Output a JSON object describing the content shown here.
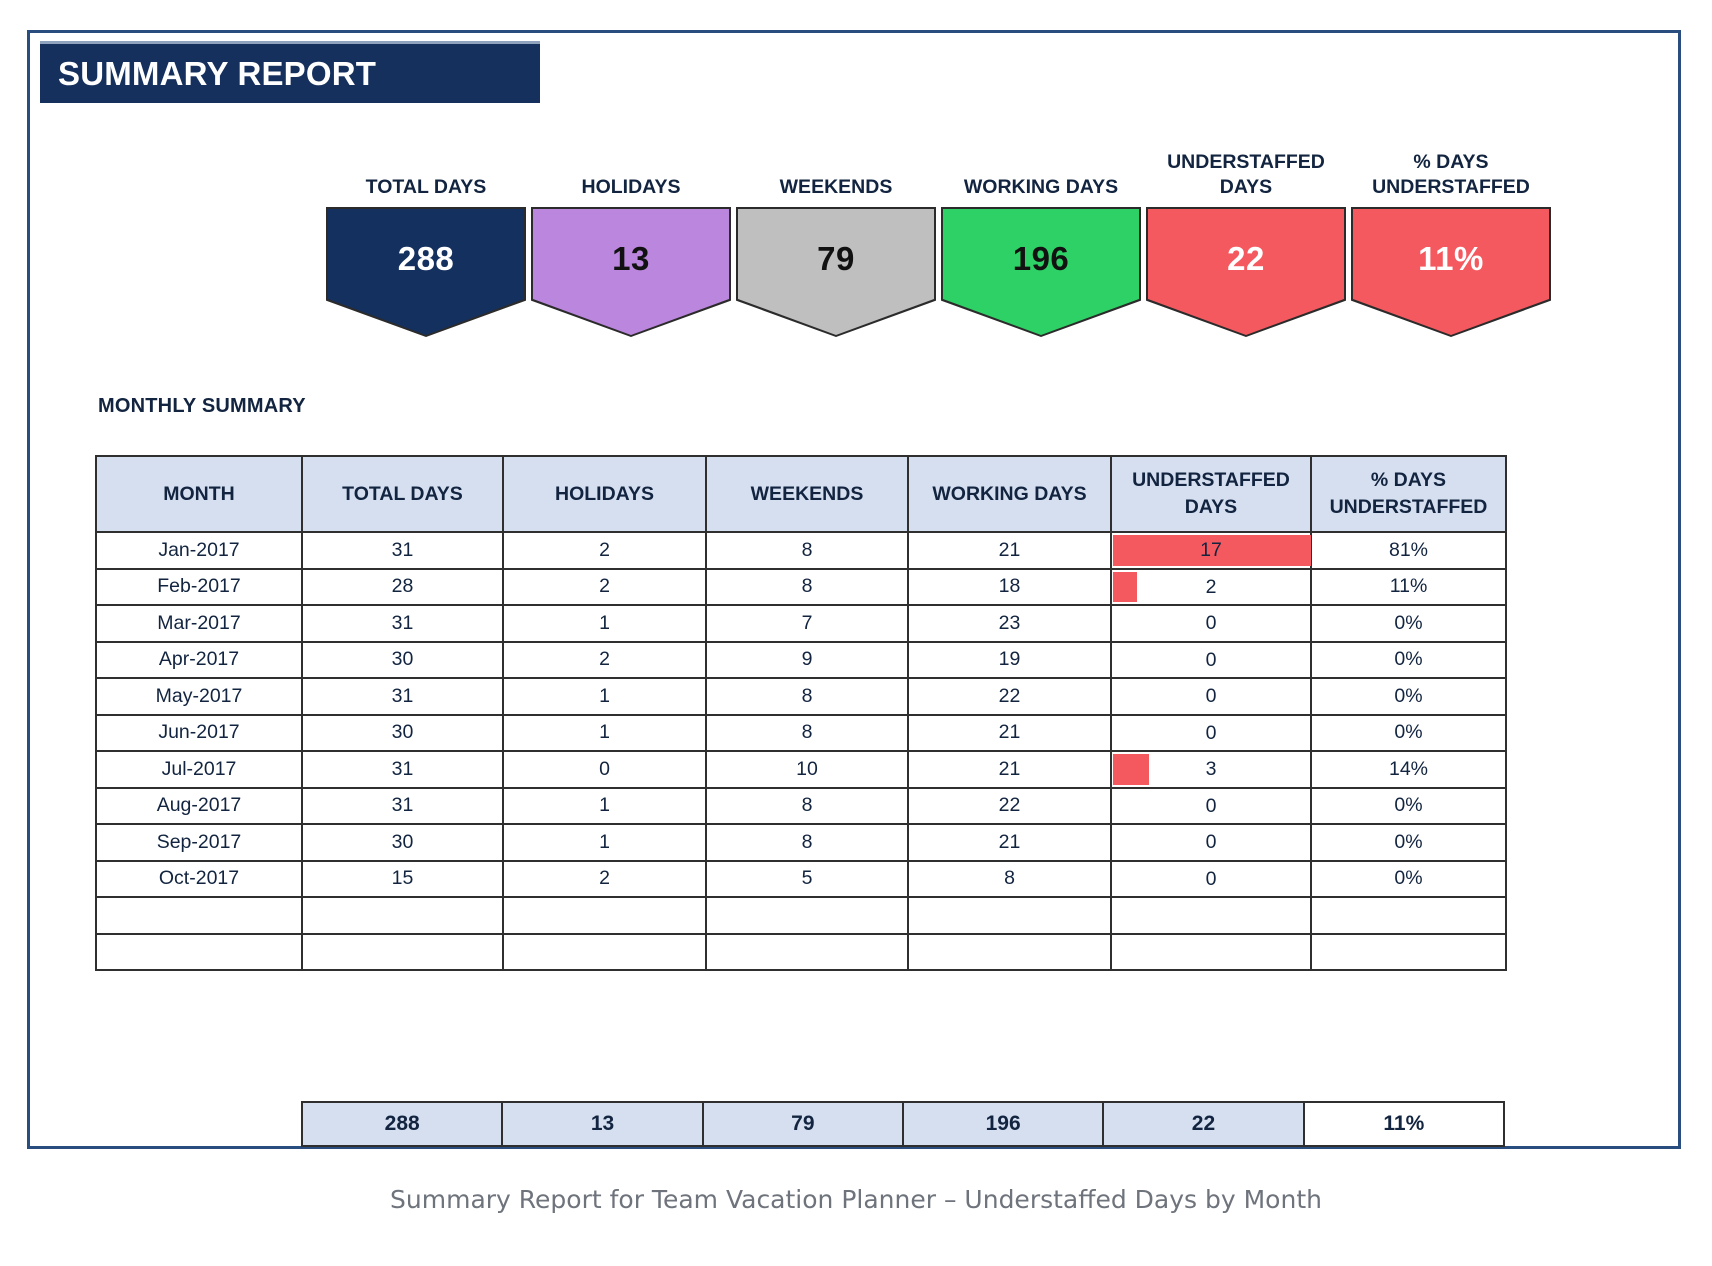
{
  "report": {
    "title": "SUMMARY REPORT",
    "section_heading": "MONTHLY SUMMARY",
    "caption": "Summary Report for Team Vacation Planner – Understaffed Days by Month"
  },
  "colors": {
    "banner_navy": "#16305e",
    "frame_blue": "#2a4d7f",
    "kpi_navy": "#14305f",
    "kpi_purple": "#bb86dd",
    "kpi_gray": "#bfbfbf",
    "kpi_green": "#2ed165",
    "kpi_red": "#f4595f",
    "header_fill": "#d6dff0",
    "bar_red": "#f4595f",
    "caption_gray": "#6e737c"
  },
  "kpis": [
    {
      "label": "TOTAL DAYS",
      "value": "288",
      "fill": "#14305f",
      "text_color": "#ffffff"
    },
    {
      "label": "HOLIDAYS",
      "value": "13",
      "fill": "#bb86dd",
      "text_color": "#111111"
    },
    {
      "label": "WEEKENDS",
      "value": "79",
      "fill": "#bfbfbf",
      "text_color": "#111111"
    },
    {
      "label": "WORKING DAYS",
      "value": "196",
      "fill": "#2ed165",
      "text_color": "#111111"
    },
    {
      "label": "UNDERSTAFFED\nDAYS",
      "value": "22",
      "fill": "#f4595f",
      "text_color": "#ffffff"
    },
    {
      "label": "% DAYS\nUNDERSTAFFED",
      "value": "11%",
      "fill": "#f4595f",
      "text_color": "#ffffff"
    }
  ],
  "table": {
    "headers": [
      "MONTH",
      "TOTAL DAYS",
      "HOLIDAYS",
      "WEEKENDS",
      "WORKING DAYS",
      "UNDERSTAFFED\nDAYS",
      "% DAYS\nUNDERSTAFFED"
    ],
    "rows": [
      {
        "month": "Jan-2017",
        "total_days": "31",
        "holidays": "2",
        "weekends": "8",
        "working_days": "21",
        "understaffed_days": "17",
        "pct_understaffed": "81%",
        "bar_pct": 100
      },
      {
        "month": "Feb-2017",
        "total_days": "28",
        "holidays": "2",
        "weekends": "8",
        "working_days": "18",
        "understaffed_days": "2",
        "pct_understaffed": "11%",
        "bar_pct": 12
      },
      {
        "month": "Mar-2017",
        "total_days": "31",
        "holidays": "1",
        "weekends": "7",
        "working_days": "23",
        "understaffed_days": "0",
        "pct_understaffed": "0%",
        "bar_pct": 0
      },
      {
        "month": "Apr-2017",
        "total_days": "30",
        "holidays": "2",
        "weekends": "9",
        "working_days": "19",
        "understaffed_days": "0",
        "pct_understaffed": "0%",
        "bar_pct": 0
      },
      {
        "month": "May-2017",
        "total_days": "31",
        "holidays": "1",
        "weekends": "8",
        "working_days": "22",
        "understaffed_days": "0",
        "pct_understaffed": "0%",
        "bar_pct": 0
      },
      {
        "month": "Jun-2017",
        "total_days": "30",
        "holidays": "1",
        "weekends": "8",
        "working_days": "21",
        "understaffed_days": "0",
        "pct_understaffed": "0%",
        "bar_pct": 0
      },
      {
        "month": "Jul-2017",
        "total_days": "31",
        "holidays": "0",
        "weekends": "10",
        "working_days": "21",
        "understaffed_days": "3",
        "pct_understaffed": "14%",
        "bar_pct": 18
      },
      {
        "month": "Aug-2017",
        "total_days": "31",
        "holidays": "1",
        "weekends": "8",
        "working_days": "22",
        "understaffed_days": "0",
        "pct_understaffed": "0%",
        "bar_pct": 0
      },
      {
        "month": "Sep-2017",
        "total_days": "30",
        "holidays": "1",
        "weekends": "8",
        "working_days": "21",
        "understaffed_days": "0",
        "pct_understaffed": "0%",
        "bar_pct": 0
      },
      {
        "month": "Oct-2017",
        "total_days": "15",
        "holidays": "2",
        "weekends": "5",
        "working_days": "8",
        "understaffed_days": "0",
        "pct_understaffed": "0%",
        "bar_pct": 0
      },
      {
        "month": "",
        "total_days": "",
        "holidays": "",
        "weekends": "",
        "working_days": "",
        "understaffed_days": "",
        "pct_understaffed": "",
        "bar_pct": 0
      },
      {
        "month": "",
        "total_days": "",
        "holidays": "",
        "weekends": "",
        "working_days": "",
        "understaffed_days": "",
        "pct_understaffed": "",
        "bar_pct": 0
      }
    ],
    "totals": [
      "288",
      "13",
      "79",
      "196",
      "22",
      "11%"
    ]
  },
  "chart_data": {
    "type": "bar",
    "title": "Understaffed Days by Month",
    "xlabel": "Month",
    "ylabel": "Understaffed Days",
    "categories": [
      "Jan-2017",
      "Feb-2017",
      "Mar-2017",
      "Apr-2017",
      "May-2017",
      "Jun-2017",
      "Jul-2017",
      "Aug-2017",
      "Sep-2017",
      "Oct-2017"
    ],
    "series": [
      {
        "name": "Total Days",
        "values": [
          31,
          28,
          31,
          30,
          31,
          30,
          31,
          31,
          30,
          15
        ]
      },
      {
        "name": "Holidays",
        "values": [
          2,
          2,
          1,
          2,
          1,
          1,
          0,
          1,
          1,
          2
        ]
      },
      {
        "name": "Weekends",
        "values": [
          8,
          8,
          7,
          9,
          8,
          8,
          10,
          8,
          8,
          5
        ]
      },
      {
        "name": "Working Days",
        "values": [
          21,
          18,
          23,
          19,
          22,
          21,
          21,
          22,
          21,
          8
        ]
      },
      {
        "name": "Understaffed Days",
        "values": [
          17,
          2,
          0,
          0,
          0,
          0,
          3,
          0,
          0,
          0
        ]
      },
      {
        "name": "% Days Understaffed",
        "values": [
          81,
          11,
          0,
          0,
          0,
          0,
          14,
          0,
          0,
          0
        ]
      }
    ],
    "totals": {
      "total_days": 288,
      "holidays": 13,
      "weekends": 79,
      "working_days": 196,
      "understaffed_days": 22,
      "pct_understaffed": "11%"
    },
    "ylim": [
      0,
      17
    ],
    "grid": false,
    "legend": "none"
  }
}
